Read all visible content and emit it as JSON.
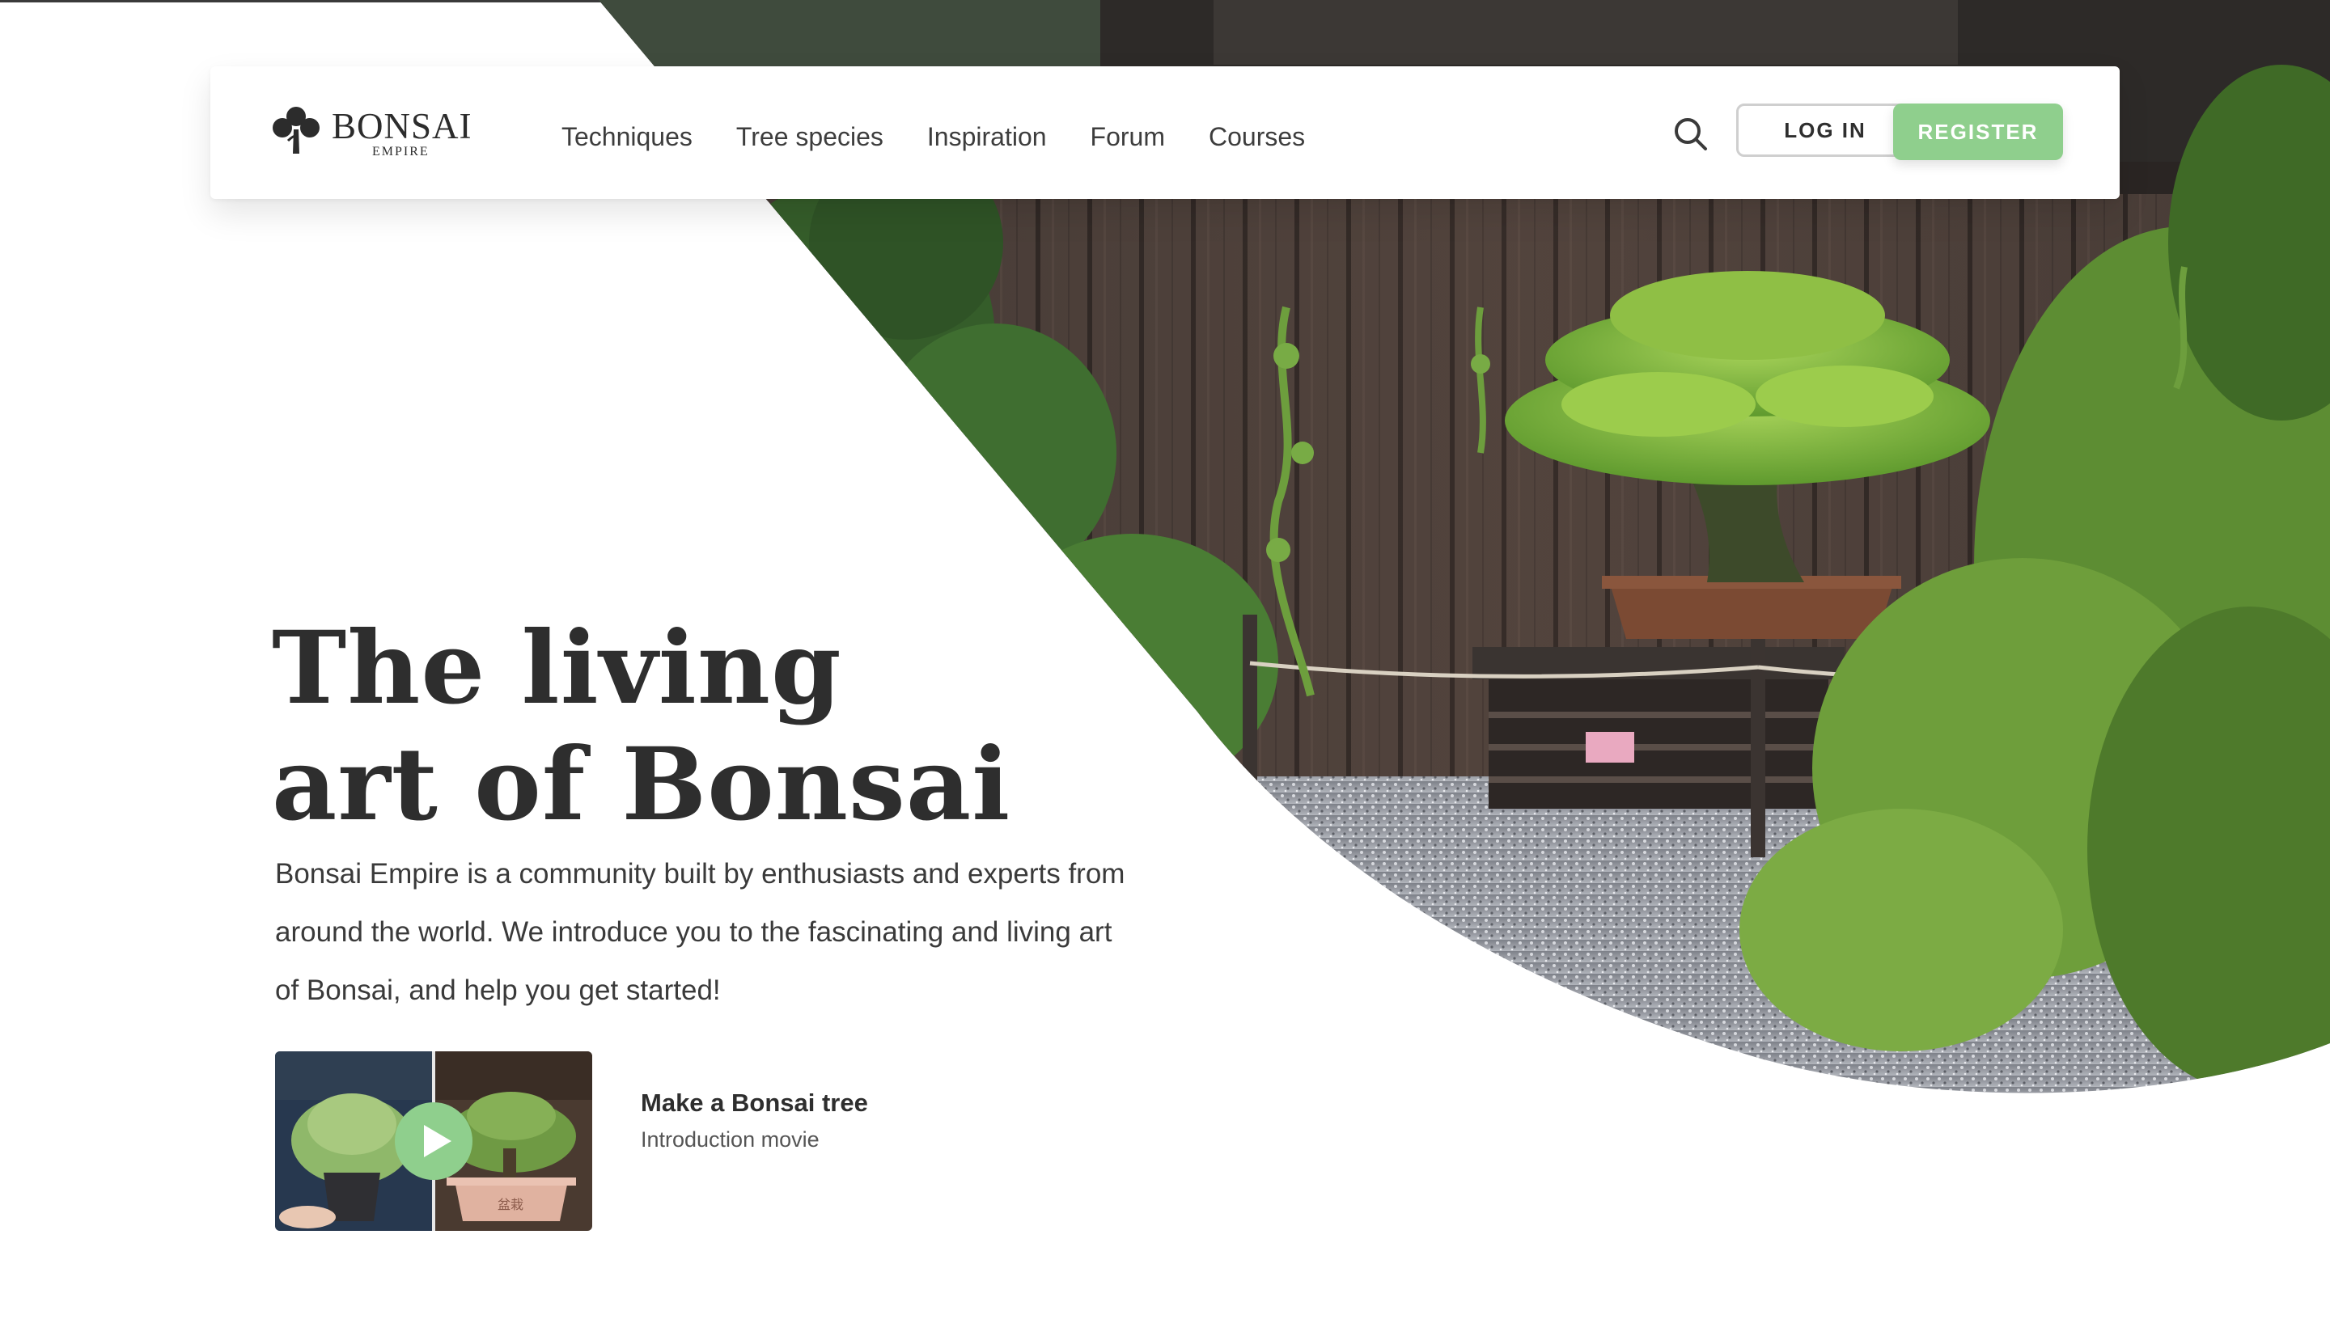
{
  "brand": {
    "name": "BONSAI",
    "tagline": "EMPIRE"
  },
  "nav": {
    "links": [
      "Techniques",
      "Tree species",
      "Inspiration",
      "Forum",
      "Courses"
    ],
    "search_icon": "search-icon",
    "login_label": "LOG IN",
    "register_label": "REGISTER"
  },
  "hero": {
    "title_line1": "The living",
    "title_line2": "art of Bonsai",
    "description": "Bonsai Empire is a community built by enthusiasts and experts from around the world. We introduce you to the fascinating and living art of Bonsai, and help you get started!"
  },
  "video": {
    "title": "Make a Bonsai tree",
    "subtitle": "Introduction movie",
    "icon": "play-icon"
  },
  "colors": {
    "accent_green": "#8fcf8d",
    "text_dark": "#2e2e2e"
  }
}
